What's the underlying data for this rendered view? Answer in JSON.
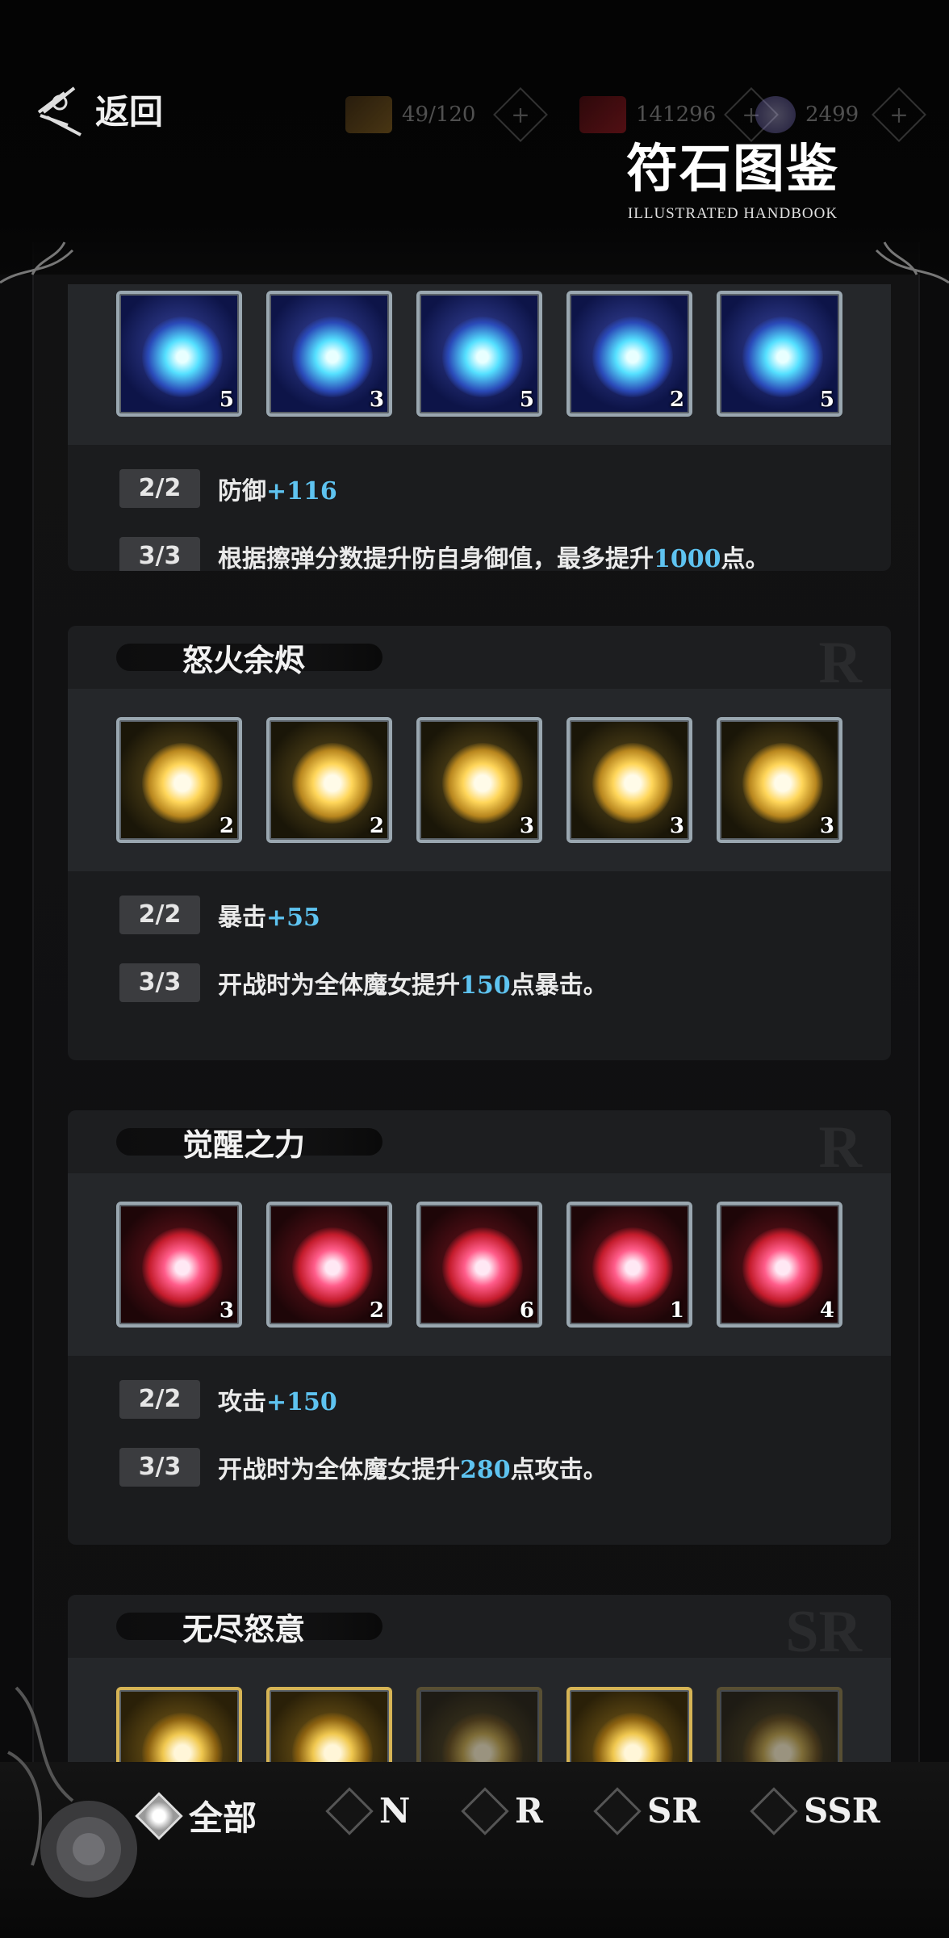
{
  "header": {
    "back_label": "返回",
    "resources": [
      {
        "icon": "card-pack-icon",
        "value": "49/120"
      },
      {
        "icon": "red-gem-icon",
        "value": "141296"
      },
      {
        "icon": "crystal-icon",
        "value": "2499"
      }
    ],
    "title": "符石图鉴",
    "subtitle": "ILLUSTRATED HANDBOOK"
  },
  "sets": [
    {
      "name": "",
      "rarity": "",
      "rune_type": "blue-vortex",
      "runes": [
        5,
        3,
        5,
        2,
        5
      ],
      "effects": [
        {
          "tier": "2/2",
          "text": "防御",
          "value": "+116",
          "suffix": ""
        },
        {
          "tier": "3/3",
          "text": "根据擦弹分数提升防自身御值，最多提升",
          "value": "1000",
          "suffix": "点。"
        }
      ]
    },
    {
      "name": "怒火余烬",
      "rarity": "R",
      "rune_type": "golden-flame",
      "runes": [
        2,
        2,
        3,
        3,
        3
      ],
      "effects": [
        {
          "tier": "2/2",
          "text": "暴击",
          "value": "+55",
          "suffix": ""
        },
        {
          "tier": "3/3",
          "text": "开战时为全体魔女提升",
          "value": "150",
          "suffix": "点暴击。"
        }
      ]
    },
    {
      "name": "觉醒之力",
      "rarity": "R",
      "rune_type": "red-crest",
      "runes": [
        3,
        2,
        6,
        1,
        4
      ],
      "effects": [
        {
          "tier": "2/2",
          "text": "攻击",
          "value": "+150",
          "suffix": ""
        },
        {
          "tier": "3/3",
          "text": "开战时为全体魔女提升",
          "value": "280",
          "suffix": "点攻击。"
        }
      ]
    },
    {
      "name": "无尽怒意",
      "rarity": "SR",
      "rune_type": "gold-demon",
      "runes": [
        null,
        null,
        null,
        null,
        null
      ],
      "effects": []
    }
  ],
  "filters": [
    {
      "label": "全部",
      "active": true
    },
    {
      "label": "N",
      "active": false
    },
    {
      "label": "R",
      "active": false
    },
    {
      "label": "SR",
      "active": false
    },
    {
      "label": "SSR",
      "active": false
    }
  ],
  "colors": {
    "highlight": "#5ec3f0",
    "card_bg": "#1b1c1e",
    "rune_row_bg": "#25272a",
    "badge_bg": "#3b3c3f"
  }
}
